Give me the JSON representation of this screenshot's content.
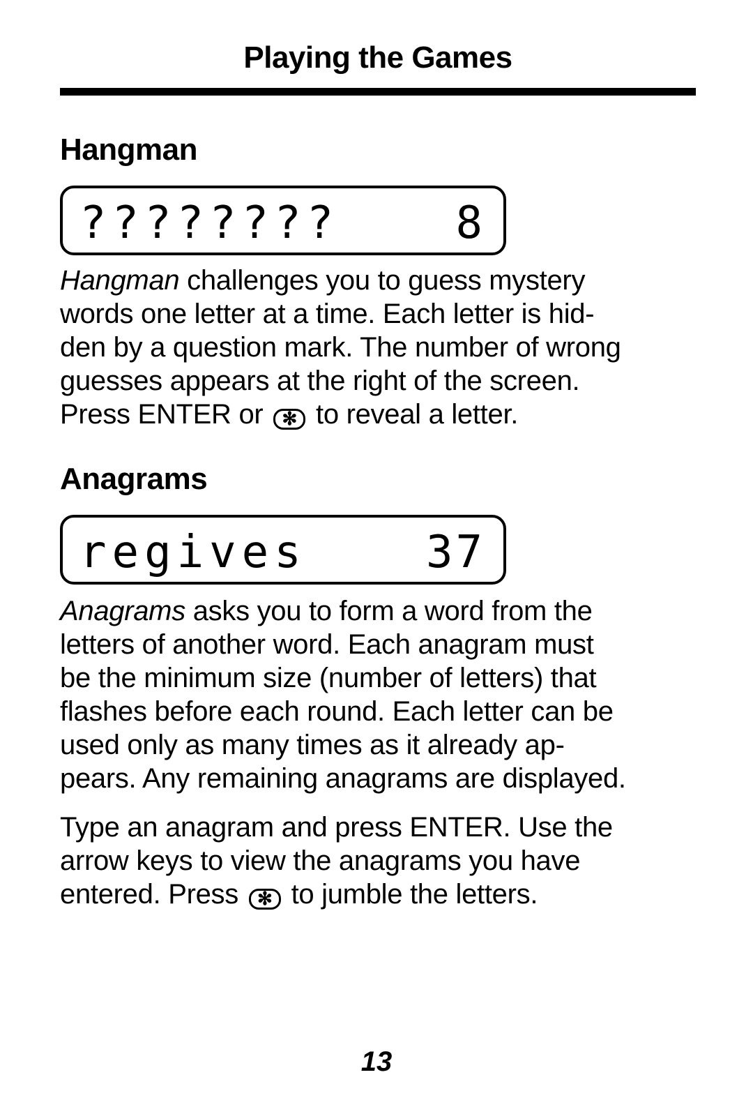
{
  "header": {
    "title": "Playing the Games"
  },
  "hangman": {
    "title": "Hangman",
    "display": {
      "text": "????????",
      "count": "8"
    },
    "paragraph": {
      "italic_lead": "Hangman",
      "lines": [
        " challenges you to guess mystery",
        "words one letter at a time. Each letter is hid-",
        "den by a question mark. The number of wrong",
        "guesses appears at the right of the screen."
      ],
      "last_pre": "Press ENTER or ",
      "last_post": " to reveal a letter."
    }
  },
  "anagrams": {
    "title": "Anagrams",
    "display": {
      "text": "regives",
      "count": "37"
    },
    "paragraph1": {
      "italic_lead": "Anagrams",
      "lines": [
        " asks you to form a word from the",
        "letters of another word.  Each anagram must",
        "be the minimum size (number of letters) that",
        "flashes before each round. Each letter can be",
        "used only as many times as it already ap-",
        "pears. Any remaining anagrams are displayed."
      ]
    },
    "paragraph2": {
      "lines": [
        "Type an anagram and press ENTER. Use the",
        "arrow keys to view the anagrams you have"
      ],
      "last_pre": "entered. Press ",
      "last_post": " to jumble the letters."
    }
  },
  "key_icon": {
    "name": "asterisk-key-icon",
    "glyph": "✻"
  },
  "page_number": "13"
}
